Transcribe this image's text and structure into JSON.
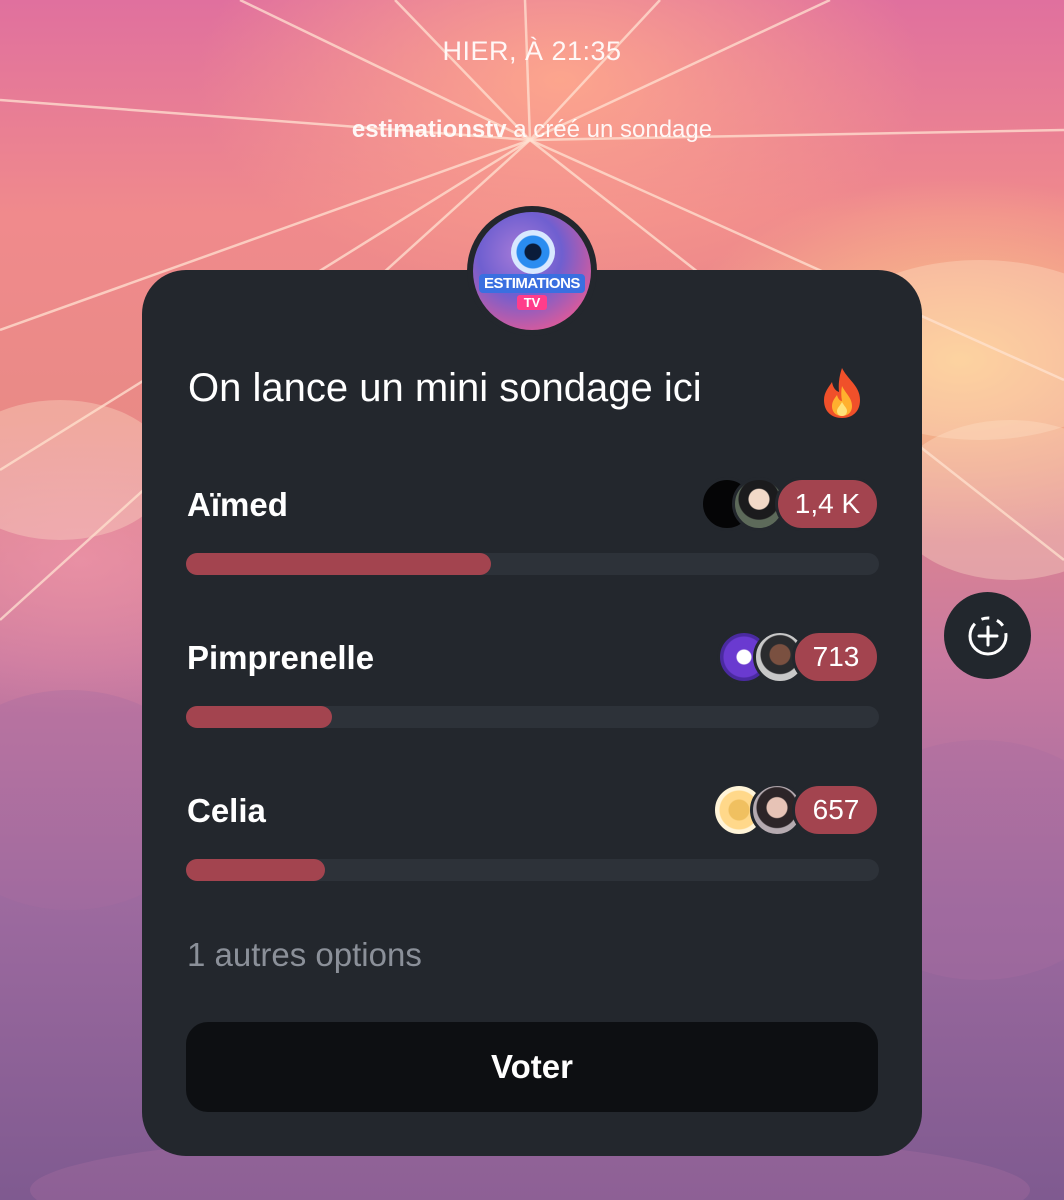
{
  "header": {
    "timestamp": "HIER, À 21:35",
    "creator_username": "estimationstv",
    "creator_action": " a créé un sondage"
  },
  "poll": {
    "logo_text": "ESTIMATIONS",
    "logo_badge": "TV",
    "title": "On lance un mini sondage ici",
    "title_emoji_icon": "fire-icon",
    "options": [
      {
        "label": "Aïmed",
        "count": "1,4 K",
        "fill_fraction": 0.44
      },
      {
        "label": "Pimprenelle",
        "count": "713",
        "fill_fraction": 0.21
      },
      {
        "label": "Celia",
        "count": "657",
        "fill_fraction": 0.2
      }
    ],
    "more_options": "1 autres options",
    "vote_label": "Voter"
  },
  "side_actions": {
    "add_icon": "circle-dashed-plus-icon"
  },
  "colors": {
    "card_bg": "#23272d",
    "bar_fill": "#a3444f",
    "bar_track": "#2d3239",
    "button_bg": "#0d0f12",
    "muted_text": "#8b9099"
  }
}
